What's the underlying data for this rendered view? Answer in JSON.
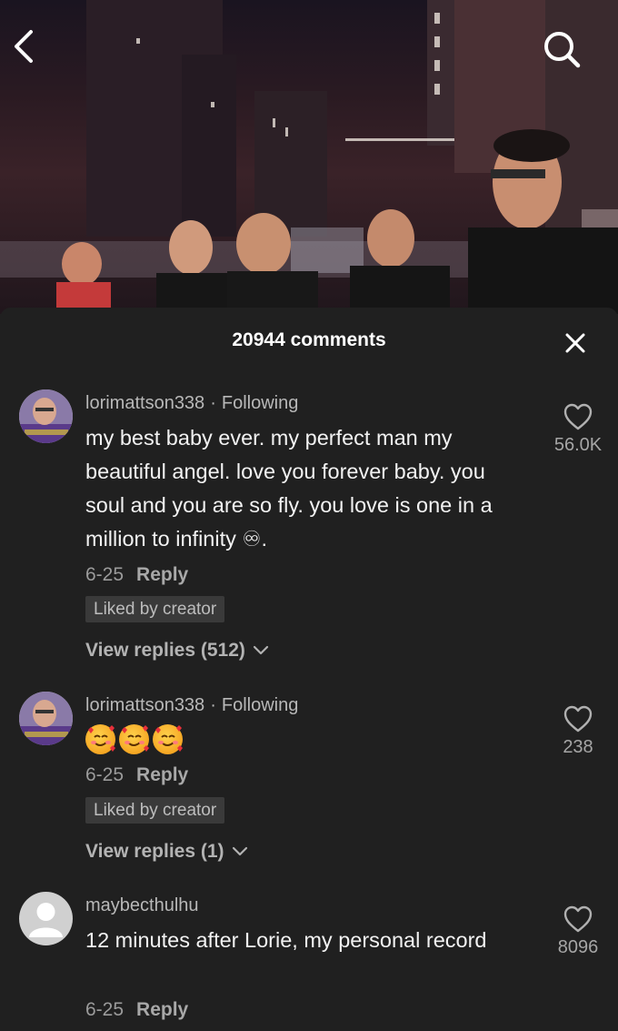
{
  "colors": {
    "background": "#202020",
    "text_primary": "#f2f2f2",
    "text_secondary": "#9b9b9b",
    "badge_bg": "#3a3a3a"
  },
  "video": {
    "back_icon": "chevron-left-icon",
    "search_icon": "search-icon"
  },
  "sheet": {
    "comment_count_label": "20944 comments",
    "close_icon": "close-icon"
  },
  "comments": [
    {
      "username": "lorimattson338",
      "separator": "·",
      "relation": "Following",
      "text": "my best baby ever. my perfect man my beautiful angel. love you forever baby. you soul and you are so fly. you love is one in a million to infinity ♾.",
      "date": "6-25",
      "reply_label": "Reply",
      "badge": "Liked by creator",
      "view_replies": "View replies (512)",
      "likes": "56.0K"
    },
    {
      "username": "lorimattson338",
      "separator": "·",
      "relation": "Following",
      "emoji_count": 3,
      "emoji_name": "smiling-face-with-hearts-emoji",
      "date": "6-25",
      "reply_label": "Reply",
      "badge": "Liked by creator",
      "view_replies": "View replies (1)",
      "likes": "238"
    },
    {
      "username": "maybecthulhu",
      "text": "12 minutes after Lorie, my personal record",
      "date": "6-25",
      "reply_label": "Reply",
      "likes": "8096"
    }
  ]
}
